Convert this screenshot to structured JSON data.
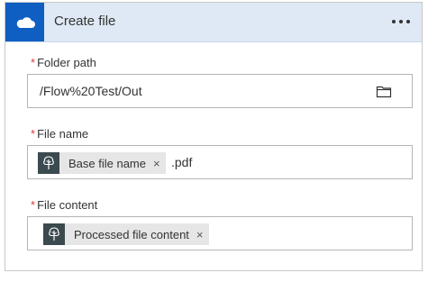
{
  "header": {
    "title": "Create file",
    "service_icon": "onedrive-cloud-icon",
    "accent_color": "#0f5ec1",
    "more_icon": "more-options-icon"
  },
  "fields": {
    "folder_path": {
      "label": "Folder path",
      "required_marker": "*",
      "value": "/Flow%20Test/Out",
      "browse_icon": "folder-icon"
    },
    "file_name": {
      "label": "File name",
      "required_marker": "*",
      "token_label": "Base file name",
      "token_icon": "tree-icon",
      "token_remove": "×",
      "suffix": ".pdf"
    },
    "file_content": {
      "label": "File content",
      "required_marker": "*",
      "token_label": "Processed file content",
      "token_icon": "tree-icon",
      "token_remove": "×"
    }
  }
}
